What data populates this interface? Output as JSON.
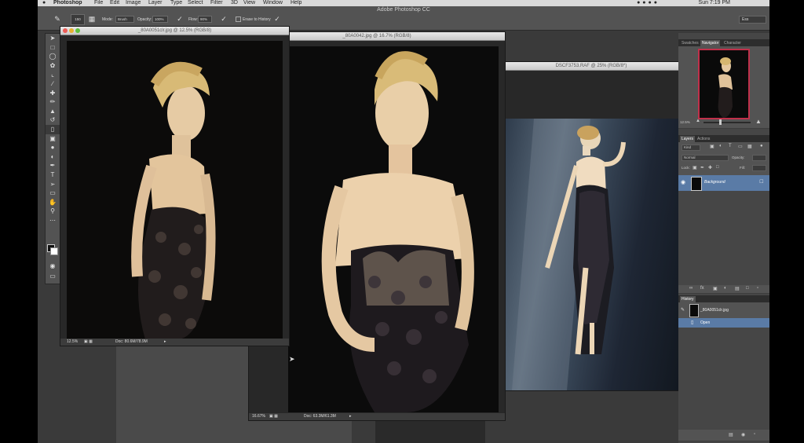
{
  "menubar": {
    "app_name": "Photoshop",
    "items": [
      "File",
      "Edit",
      "Image",
      "Layer",
      "Type",
      "Select",
      "Filter",
      "3D",
      "View",
      "Window",
      "Help"
    ],
    "clock": "Sun 7:19 PM"
  },
  "options_bar": {
    "app_title": "Adobe Photoshop CC",
    "brush_size": "150",
    "mode_label": "Mode:",
    "mode_value": "Brush",
    "opacity_label": "Opacity:",
    "opacity_value": "100%",
    "flow_label": "Flow:",
    "flow_value": "90%",
    "erase_label": "Erase to History",
    "workspace": "Ess"
  },
  "documents": [
    {
      "title": "_80A0051clr.jpg @ 12.5% (RGB/8)",
      "zoom": "12.5%",
      "doc_info": "Doc: 80.6M/78.9M"
    },
    {
      "title": "_80A0042.jpg @ 16.7% (RGB/8)",
      "zoom": "16.67%",
      "doc_info": "Doc: 63.3M/61.3M"
    },
    {
      "title": "DSCF3753.RAF @ 25% (RGB/8*)"
    }
  ],
  "panels": {
    "top_tabs": [
      "Swatches",
      "Navigator",
      "Character"
    ],
    "navigator_zoom": "12.5%",
    "layers_tabs": [
      "Layers",
      "Actions"
    ],
    "kind_label": "Kind",
    "blend_mode": "Normal",
    "opacity_label": "Opacity:",
    "lock_label": "Lock:",
    "fill_label": "Fill:",
    "layer_name": "Background",
    "history_tab": "History",
    "history_snapshot": "_80A0051clr.jpg",
    "history_state": "Open"
  },
  "colors": {
    "selection": "#5a7ba6",
    "panel_bg": "#464646",
    "navigator_frame": "#c0304a"
  }
}
